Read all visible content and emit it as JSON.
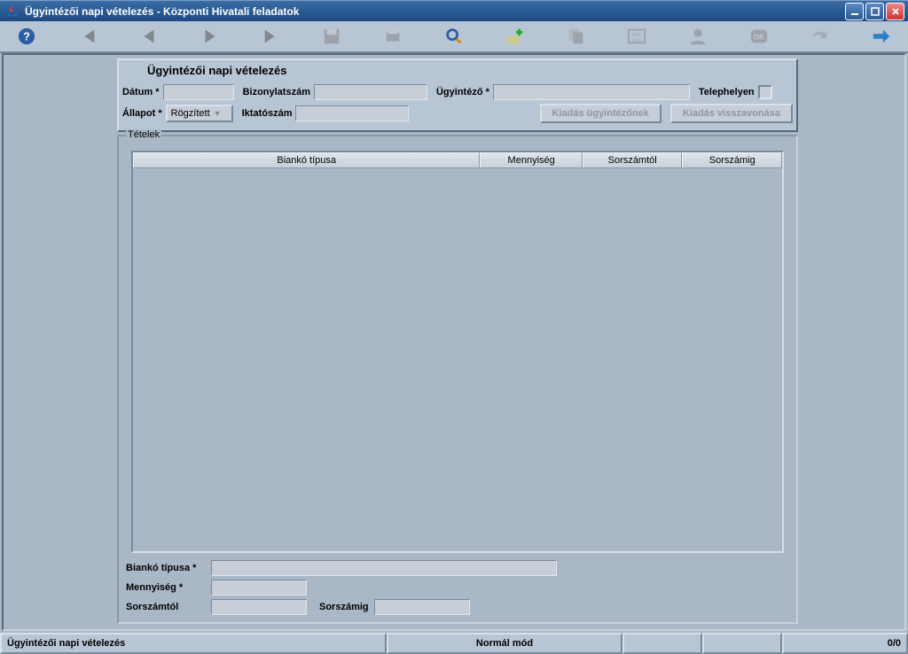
{
  "window": {
    "title": "Ügyintézői napi vételezés - Központi Hivatali feladatok"
  },
  "toolbar_icons": [
    "help",
    "first",
    "prev",
    "next",
    "last",
    "save",
    "print",
    "search",
    "add",
    "copy",
    "abc",
    "user",
    "ok",
    "undo",
    "forward"
  ],
  "form": {
    "group_title": "Ügyintézői napi vételezés",
    "labels": {
      "date": "Dátum *",
      "docnum": "Bizonylatszám",
      "agent": "Ügyintéző *",
      "onsite": "Telephelyen",
      "status": "Állapot *",
      "regnum": "Iktatószám"
    },
    "status_value": "Rögzített",
    "buttons": {
      "assign": "Kiadás ügyintézőnek",
      "revoke": "Kiadás visszavonása"
    }
  },
  "items": {
    "legend": "Tételek",
    "columns": [
      "Biankó típusa",
      "Mennyiség",
      "Sorszámtól",
      "Sorszámig"
    ],
    "rows": [],
    "lower": {
      "type": "Biankó típusa *",
      "qty": "Mennyiség *",
      "from": "Sorszámtól",
      "to": "Sorszámig"
    }
  },
  "status": {
    "left": "Ügyintézői napi vételezés",
    "mode": "Normál mód",
    "count": "0/0"
  }
}
